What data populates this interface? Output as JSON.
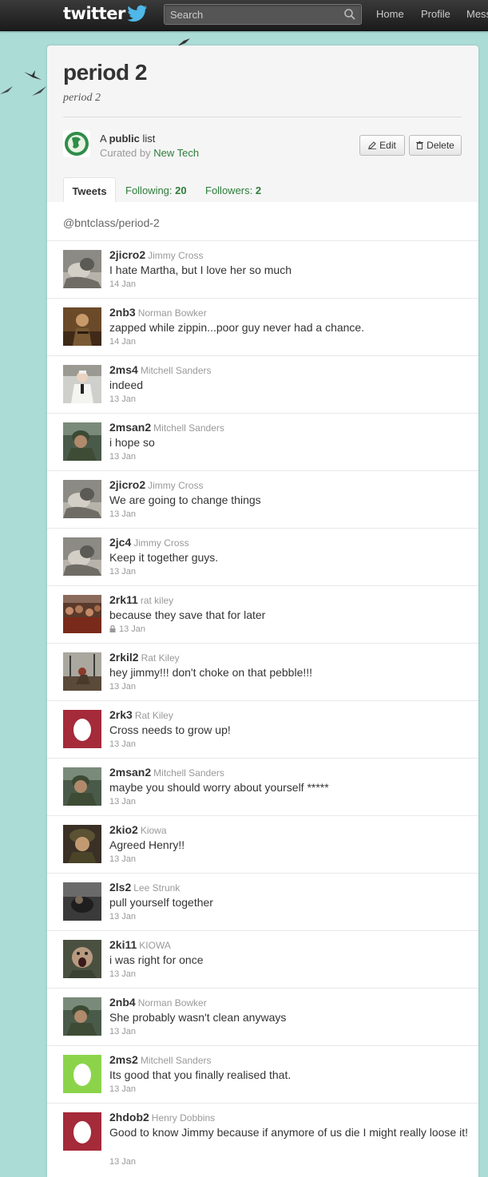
{
  "topbar": {
    "logo": "twitter",
    "search_placeholder": "Search",
    "nav": [
      "Home",
      "Profile",
      "Mess"
    ]
  },
  "list": {
    "title": "period 2",
    "subtitle": "period 2",
    "visibility_prefix": "A",
    "visibility_word": "public",
    "visibility_suffix": "list",
    "curated_prefix": "Curated by",
    "curator": "New Tech",
    "edit_label": "Edit",
    "delete_label": "Delete"
  },
  "tabs": {
    "tweets": "Tweets",
    "following_label": "Following:",
    "following_count": "20",
    "followers_label": "Followers:",
    "followers_count": "2"
  },
  "stream": {
    "handle": "@bntclass/period-2"
  },
  "tweets": [
    {
      "user": "2jicro2",
      "name": "Jimmy Cross",
      "text": "I hate Martha, but I love her so much",
      "time": "14 Jan",
      "avatar": "sepia-photo",
      "locked": false
    },
    {
      "user": "2nb3",
      "name": "Norman Bowker",
      "text": "zapped while zippin...poor guy never had a chance.",
      "time": "14 Jan",
      "avatar": "brown-photo",
      "locked": false
    },
    {
      "user": "2ms4",
      "name": "Mitchell Sanders",
      "text": "indeed",
      "time": "13 Jan",
      "avatar": "white-suit-photo",
      "locked": false
    },
    {
      "user": "2msan2",
      "name": "Mitchell Sanders",
      "text": "i hope so",
      "time": "13 Jan",
      "avatar": "soldier-photo",
      "locked": false
    },
    {
      "user": "2jicro2",
      "name": "Jimmy Cross",
      "text": "We are going to change things",
      "time": "13 Jan",
      "avatar": "sepia-photo",
      "locked": false
    },
    {
      "user": "2jc4",
      "name": "Jimmy Cross",
      "text": "Keep it together guys.",
      "time": "13 Jan",
      "avatar": "sepia-photo",
      "locked": false
    },
    {
      "user": "2rk11",
      "name": "rat kiley",
      "text": "because they save that for later",
      "time": "13 Jan",
      "avatar": "crowd-photo",
      "locked": true
    },
    {
      "user": "2rkil2",
      "name": "Rat Kiley",
      "text": "hey jimmy!!! don't choke on that pebble!!!",
      "time": "13 Jan",
      "avatar": "field-photo",
      "locked": false
    },
    {
      "user": "2rk3",
      "name": "Rat Kiley",
      "text": "Cross needs to grow up!",
      "time": "13 Jan",
      "avatar": "egg-red",
      "locked": false
    },
    {
      "user": "2msan2",
      "name": "Mitchell Sanders",
      "text": "maybe you should worry about yourself *****",
      "time": "13 Jan",
      "avatar": "soldier-photo",
      "locked": false
    },
    {
      "user": "2kio2",
      "name": "Kiowa",
      "text": "Agreed Henry!!",
      "time": "13 Jan",
      "avatar": "helmet-photo",
      "locked": false
    },
    {
      "user": "2ls2",
      "name": "Lee Strunk",
      "text": "pull yourself together",
      "time": "13 Jan",
      "avatar": "dark-photo",
      "locked": false
    },
    {
      "user": "2ki11",
      "name": "KIOWA",
      "text": "i was right for once",
      "time": "13 Jan",
      "avatar": "scream-photo",
      "locked": false
    },
    {
      "user": "2nb4",
      "name": "Norman Bowker",
      "text": "She probably wasn't clean anyways",
      "time": "13 Jan",
      "avatar": "soldier-photo",
      "locked": false
    },
    {
      "user": "2ms2",
      "name": "Mitchell Sanders",
      "text": "Its good that you finally realised that.",
      "time": "13 Jan",
      "avatar": "egg-green",
      "locked": false
    },
    {
      "user": "2hdob2",
      "name": "Henry Dobbins",
      "text": "Good to know Jimmy because if anymore of us die I might really loose it!",
      "time": "13 Jan",
      "avatar": "egg-red",
      "locked": false
    }
  ],
  "colors": {
    "background": "#abdcd6",
    "topbar": "#1b1b1b",
    "link": "#2d7d3a",
    "egg_red": "#a52a3a",
    "egg_green": "#8bd44a"
  }
}
